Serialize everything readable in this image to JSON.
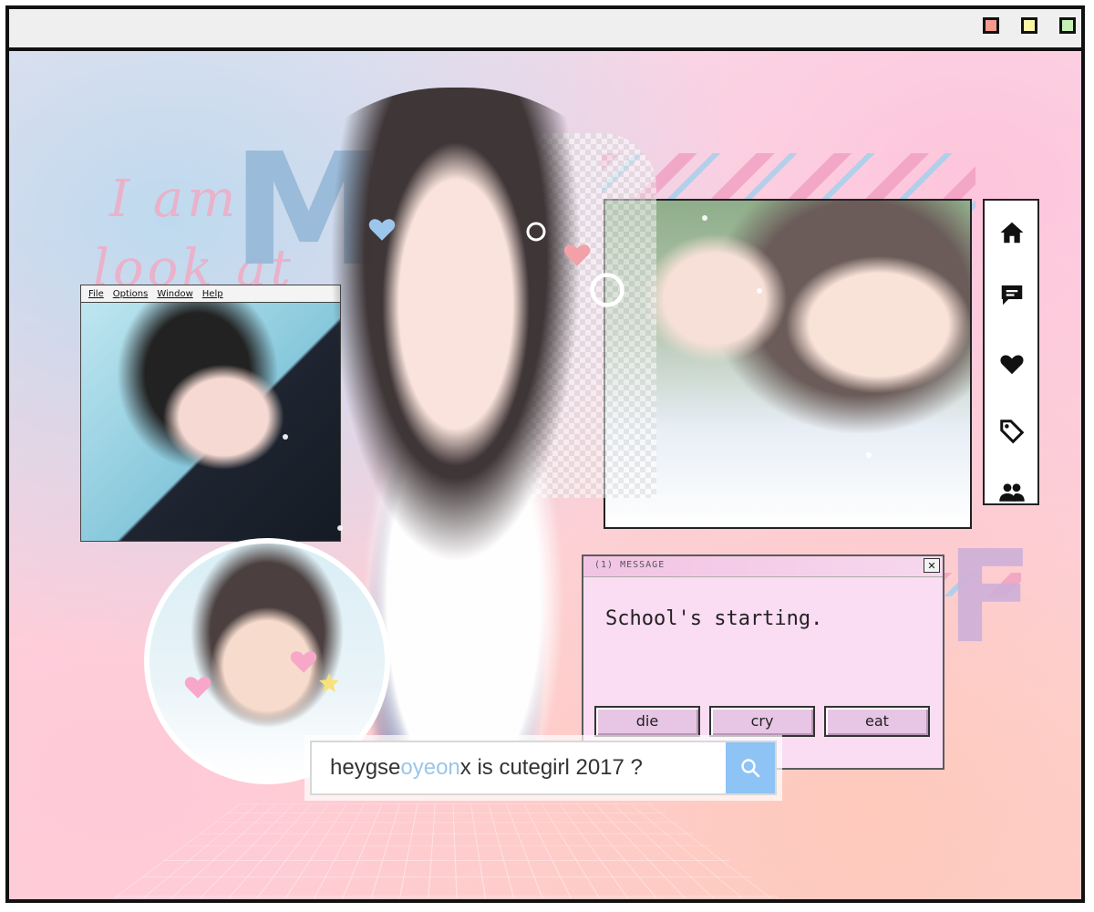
{
  "window": {
    "controls": {
      "red_color": "#f49a8e",
      "yellow_color": "#fbf5a6",
      "green_color": "#c4f0b5"
    }
  },
  "decor": {
    "script_line1": "I am",
    "script_line2": "look at",
    "big_letter_top": "M",
    "big_letter_bottom": "F"
  },
  "retro_window": {
    "menu": [
      "File",
      "Options",
      "Window",
      "Help"
    ]
  },
  "side_toolbar": {
    "icons": [
      "home-icon",
      "chat-icon",
      "heart-icon",
      "tag-icon",
      "users-icon"
    ]
  },
  "message_dialog": {
    "title": "(1) MESSAGE",
    "close_label": "✕",
    "text": "School's starting.",
    "buttons": [
      "die",
      "cry",
      "eat"
    ]
  },
  "search": {
    "query_part1": "heygse",
    "query_part2": "oyeon",
    "query_part3": "x is cutegirl 2017 ?",
    "button_icon": "search-icon"
  }
}
